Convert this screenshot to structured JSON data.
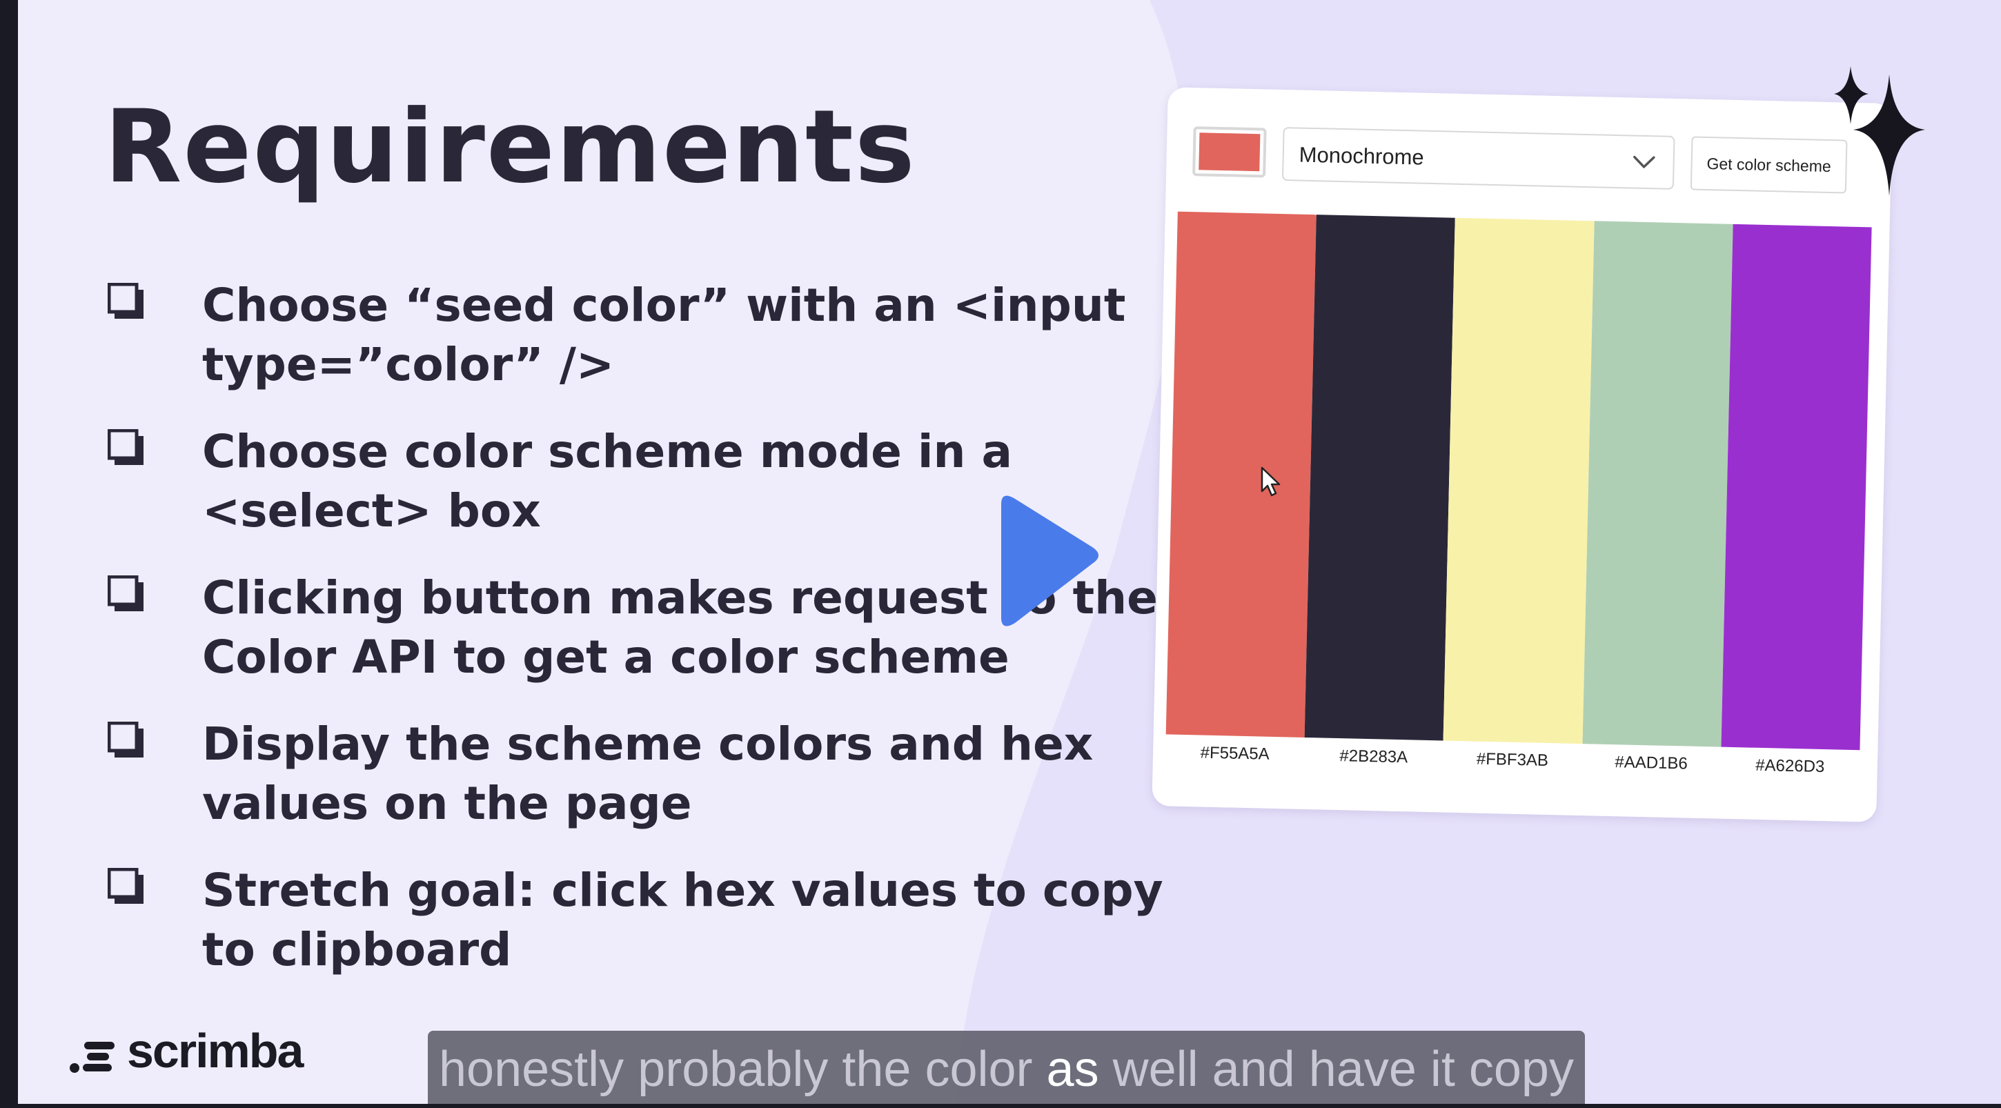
{
  "slide": {
    "title": "Requirements",
    "requirements": [
      {
        "lines": [
          "Choose “seed color” with an <input",
          "type=”color” />"
        ]
      },
      {
        "lines": [
          "Choose color scheme mode in a",
          "<select> box"
        ]
      },
      {
        "lines": [
          "Clicking button makes request to the",
          "Color API to get a color scheme"
        ]
      },
      {
        "lines": [
          "Display the scheme colors and hex",
          "values on the page"
        ]
      },
      {
        "lines": [
          "Stretch goal: click hex values to copy",
          "to clipboard"
        ]
      }
    ]
  },
  "app_preview": {
    "seed_color": "#E1655D",
    "mode_selected": "Monochrome",
    "button_label": "Get color scheme",
    "colors": [
      {
        "hex": "#F55A5A",
        "fill": "#E1655D"
      },
      {
        "hex": "#2B283A",
        "fill": "#2A2838"
      },
      {
        "hex": "#FBF3AB",
        "fill": "#F8F1AA"
      },
      {
        "hex": "#AAD1B6",
        "fill": "#AFCFB5"
      },
      {
        "hex": "#A626D3",
        "fill": "#9A2FCF"
      }
    ]
  },
  "player": {
    "play_color": "#4A7BEA",
    "caption_before": "honestly probably the color ",
    "caption_highlight": "as",
    "caption_after": " well and have it copy"
  },
  "brand": {
    "logo_text": "scrimba"
  },
  "colors": {
    "slide_bg": "#EFEDFB",
    "panel_bg": "#E6E1FA",
    "text": "#2A2838"
  }
}
